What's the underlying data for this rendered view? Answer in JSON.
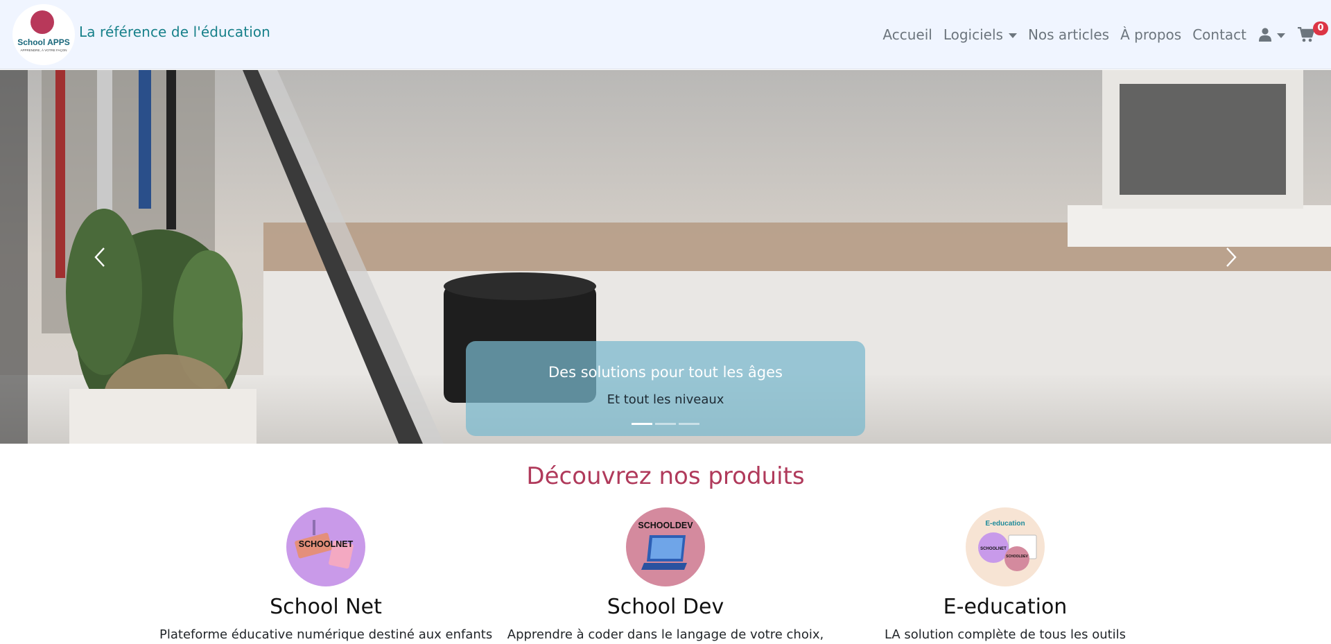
{
  "navbar": {
    "logo_text": "School APPS",
    "logo_tagline": "APPRENDRE À VOTRE FAÇON",
    "brand": "La référence de l'éducation",
    "links": {
      "home": "Accueil",
      "software": "Logiciels",
      "articles": "Nos articles",
      "about": "À propos",
      "contact": "Contact"
    },
    "cart_count": "0"
  },
  "carousel": {
    "caption_title": "Des solutions pour tout les âges",
    "caption_text": "Et tout les niveaux",
    "slide_count": 3,
    "active_slide": 1
  },
  "products": {
    "title": "Découvrez nos produits",
    "items": [
      {
        "name": "School Net",
        "icon_label": "SCHOOLNET",
        "description": "Plateforme éducative numérique destiné aux enfants",
        "color": "#c79ae8"
      },
      {
        "name": "School Dev",
        "icon_label": "SCHOOLDEV",
        "description": "Apprendre à coder dans le langage de votre choix,",
        "color": "#d48a9e"
      },
      {
        "name": "E-education",
        "icon_label": "E-education",
        "description": "LA solution complète de tous les outils",
        "color": "#f7e4d4"
      }
    ]
  },
  "colors": {
    "brand_teal": "#17808a",
    "title_rose": "#b03a5b",
    "badge_red": "#dc3545",
    "navbar_bg": "#f0f5ff"
  }
}
